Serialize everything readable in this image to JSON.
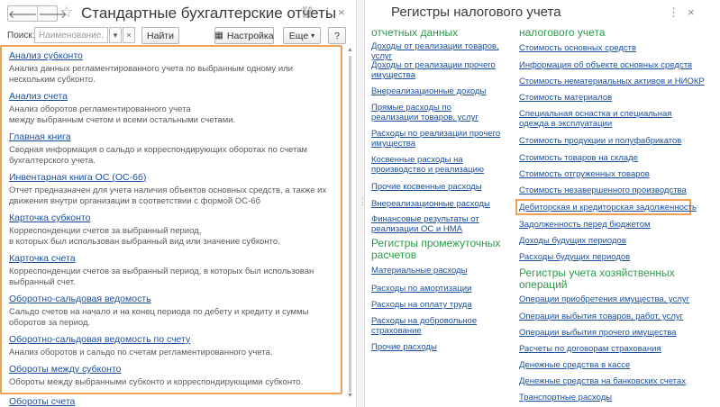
{
  "left_window": {
    "nav": {
      "back": "🡐",
      "forward": "🡒"
    },
    "title": "Стандартные бухгалтерские отчеты",
    "title_icons": {
      "link": "⛓",
      "menu": "⋮",
      "close": "×"
    },
    "toolbar": {
      "search_label": "Поиск:",
      "search_placeholder": "Наименование, ...",
      "dropdown_glyph": "▾",
      "clear_glyph": "×",
      "find_button": "Найти",
      "settings_button": "Настройка",
      "more_button": "Еще",
      "help_button": "?"
    },
    "reports": [
      {
        "title": "Анализ субконто",
        "desc": "Анализ данных регламентированного учета по выбранным одному или нескольким субконто."
      },
      {
        "title": "Анализ счета",
        "desc": "Анализ оборотов регламентированного учета\nмежду выбранным счетом и всеми остальными счетами."
      },
      {
        "title": "Главная книга",
        "desc": "Сводная информация о сальдо и корреспондирующих оборотах по счетам бухгалтерского учета."
      },
      {
        "title": "Инвентарная книга ОС (ОС-6б)",
        "desc": "Отчет предназначен для учета наличия объектов основных средств, а также их движения внутри организации в соответствии с формой ОС-6б"
      },
      {
        "title": "Карточка субконто",
        "desc": "Корреспонденции счетов за выбранный период,\nв которых был использован выбранный вид  или значение субконто."
      },
      {
        "title": "Карточка счета",
        "desc": "Корреспонденции счетов за выбранный период, в которых был использован выбранный счет."
      },
      {
        "title": "Оборотно-сальдовая ведомость",
        "desc": "Сальдо счетов на начало и на конец периода по дебету и кредиту и суммы оборотов за период."
      },
      {
        "title": "Оборотно-сальдовая ведомость по счету",
        "desc": "Анализ оборотов и сальдо по счетам регламентированного учета."
      },
      {
        "title": "Обороты между субконто",
        "desc": "Обороты между выбранными субконто и корреспондирующими субконто."
      },
      {
        "title": "Обороты счета",
        "desc": ""
      }
    ]
  },
  "right_window": {
    "title": "Регистры налогового учета",
    "title_icons": {
      "menu": "⋮",
      "close": "×"
    },
    "left_column": {
      "top_header": "отчетных данных",
      "top_links": [
        "Доходы от реализации товаров, услуг",
        "Доходы от реализации прочего имущества",
        "Внереализационные доходы",
        "Прямые расходы по реализации товаров, услуг",
        "Расходы по реализации прочего имущества",
        "Косвенные расходы на производство и реализацию",
        "Прочие косвенные расходы",
        "Внереализационные расходы",
        "Финансовые результаты от реализации ОС и НМА"
      ],
      "section_header": "Регистры промежуточных расчетов",
      "section_links": [
        "Материальные расходы",
        "Расходы по амортизации",
        "Расходы на оплату труда",
        "Расходы на добровольное страхование",
        "Прочие расходы"
      ]
    },
    "right_column": {
      "top_header": "налогового учета",
      "top_links": [
        "Стоимость основных средств",
        "Информация об объекте основных средств",
        "Стоимость нематериальных активов и НИОКР",
        "Стоимость материалов",
        "Специальная оснастка и специальная одежда в эксплуатации",
        "Стоимость продукции и полуфабрикатов",
        "Стоимость товаров на складе",
        "Стоимость отгруженных товаров",
        "Стоимость незавершенного производства",
        "Дебиторская и кредиторская задолженность",
        "Задолженность перед бюджетом",
        "Доходы будущих периодов",
        "Расходы будущих периодов"
      ],
      "section_header": "Регистры учета хозяйственных операций",
      "section_links": [
        "Операции приобретения имущества, услуг",
        "Операции выбытия товаров, работ, услуг",
        "Операции выбытия прочего имущества",
        "Расчеты по договорам страхования",
        "Денежные средства в кассе",
        "Денежные средства на банковских счетах",
        "Транспортные расходы"
      ]
    }
  },
  "colors": {
    "link": "#1a4f9c",
    "section_header": "#2f9a4c",
    "highlight_frame": "#f0a153"
  }
}
